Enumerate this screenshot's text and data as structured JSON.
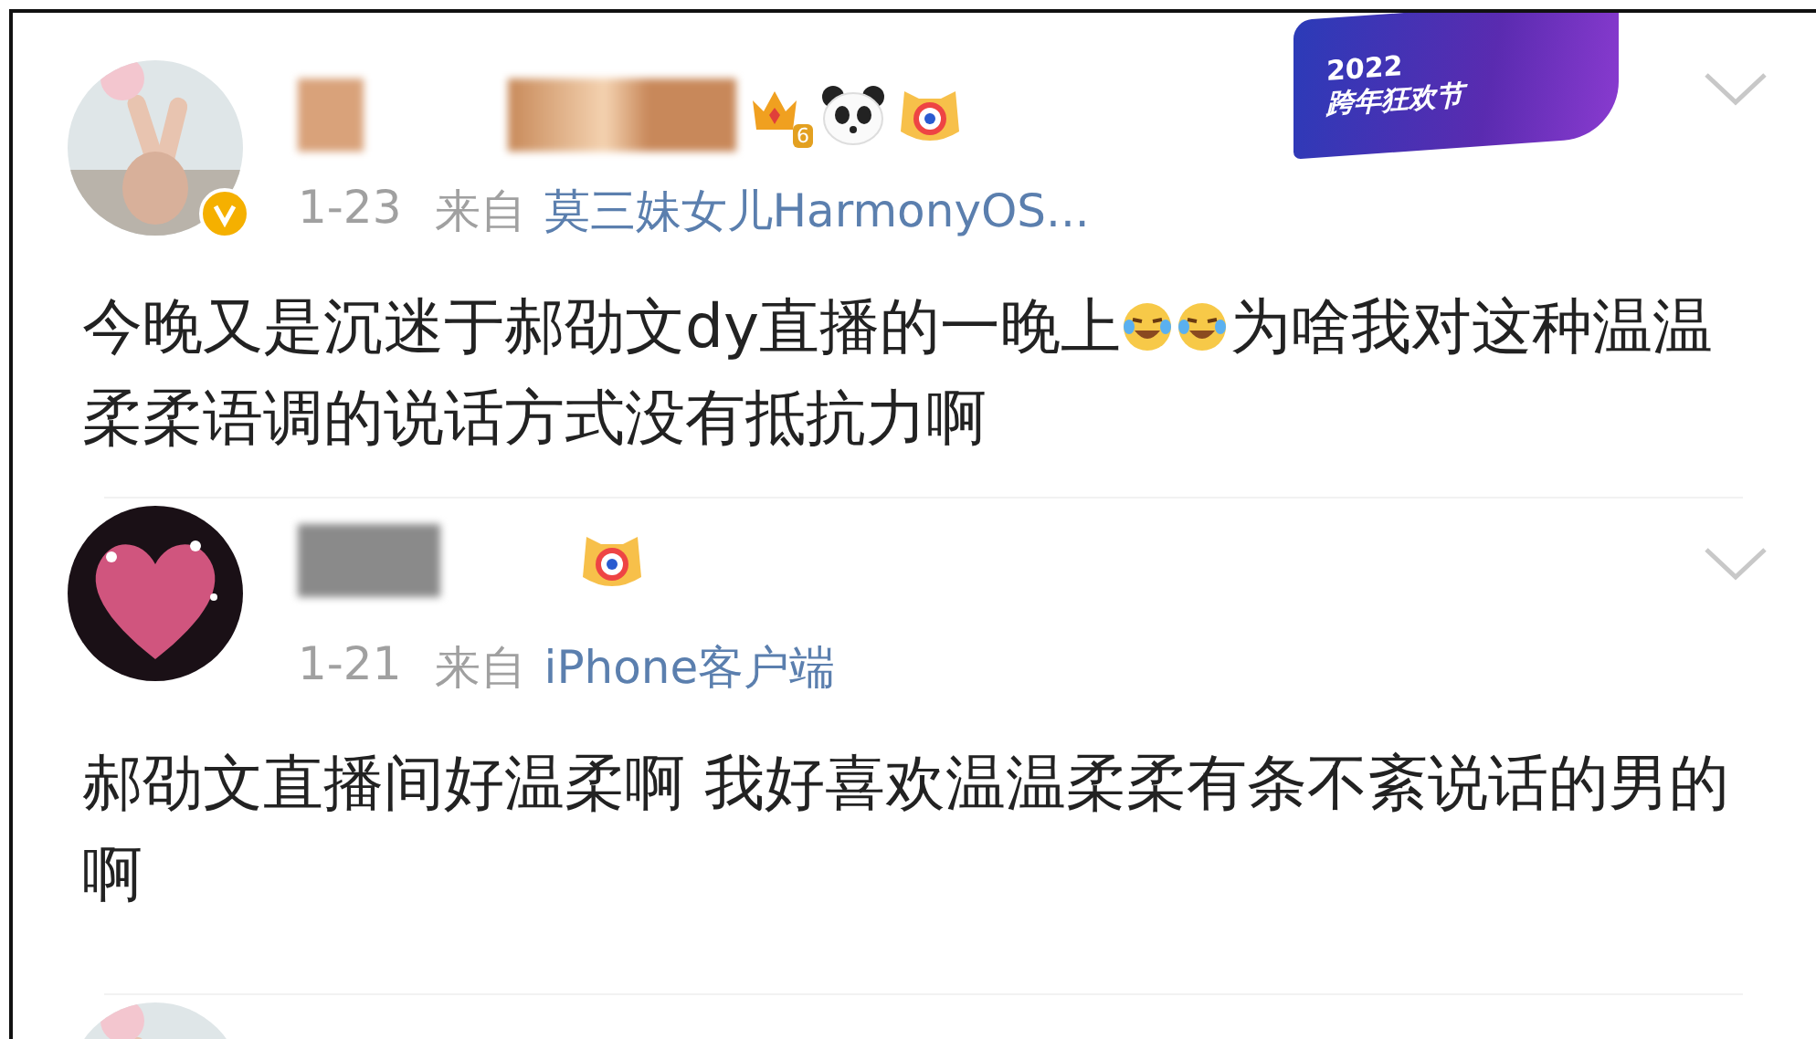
{
  "posts": [
    {
      "avatar": {
        "kind": "picture",
        "verified": true
      },
      "name_badges": [
        {
          "kind": "crown",
          "text": "6"
        },
        {
          "kind": "panda"
        },
        {
          "kind": "tiger"
        }
      ],
      "banner": {
        "year": "2022",
        "title": "跨年狂欢节"
      },
      "time": "1-23",
      "source_label": "来自",
      "source": "莫三妹女儿HarmonyOS...",
      "body": [
        {
          "kind": "text",
          "text": "今晚又是沉迷于郝劭文dy直播的一晚上"
        },
        {
          "kind": "emoji"
        },
        {
          "kind": "emoji"
        },
        {
          "kind": "text",
          "text": "为啥我对这种温温柔柔语调的说话方式没有抵抗力啊"
        }
      ]
    },
    {
      "avatar": {
        "kind": "heart",
        "verified": false
      },
      "name_badges": [
        {
          "kind": "tiger"
        }
      ],
      "time": "1-21",
      "source_label": "来自",
      "source": "iPhone客户端",
      "body": [
        {
          "kind": "text",
          "text": "郝劭文直播间好温柔啊 我好喜欢温温柔柔有条不紊说话的男的啊"
        }
      ]
    },
    {
      "avatar": {
        "kind": "picture",
        "verified": false
      }
    }
  ]
}
